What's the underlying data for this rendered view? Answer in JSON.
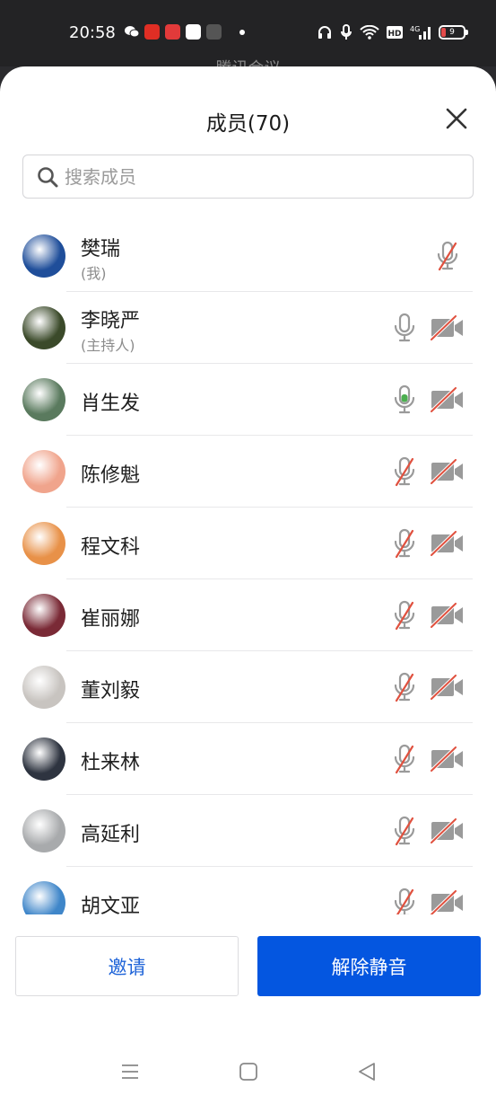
{
  "status_bar": {
    "time": "20:58",
    "battery": "9",
    "app_icons": [
      "wechat-icon",
      "pinduoduo-icon",
      "toutiao-icon",
      "baidu-icon",
      "music-icon"
    ],
    "system_icons": [
      "headphones-icon",
      "mic-icon",
      "wifi-icon",
      "hd-icon",
      "signal-icon",
      "battery-icon"
    ]
  },
  "background_title": "腾讯会议",
  "sheet": {
    "title": "成员(70)",
    "search_placeholder": "搜索成员"
  },
  "members": [
    {
      "name": "樊瑞",
      "role": "(我)",
      "mic": "muted",
      "camera": "none",
      "avatar_color": "#1f4e9a"
    },
    {
      "name": "李晓严",
      "role": "(主持人)",
      "mic": "on",
      "camera": "off",
      "avatar_color": "#3b4a2a"
    },
    {
      "name": "肖生发",
      "role": "",
      "mic": "speaking",
      "camera": "off",
      "avatar_color": "#5a7a5e"
    },
    {
      "name": "陈修魁",
      "role": "",
      "mic": "muted",
      "camera": "off",
      "avatar_color": "#f0a48c"
    },
    {
      "name": "程文科",
      "role": "",
      "mic": "muted",
      "camera": "off",
      "avatar_color": "#e89148"
    },
    {
      "name": "崔丽娜",
      "role": "",
      "mic": "muted",
      "camera": "off",
      "avatar_color": "#7a2a36"
    },
    {
      "name": "董刘毅",
      "role": "",
      "mic": "muted",
      "camera": "off",
      "avatar_color": "#c8c4c0"
    },
    {
      "name": "杜来林",
      "role": "",
      "mic": "muted",
      "camera": "off",
      "avatar_color": "#2e3440"
    },
    {
      "name": "高延利",
      "role": "",
      "mic": "muted",
      "camera": "off",
      "avatar_color": "#a8aaac"
    },
    {
      "name": "胡文亚",
      "role": "",
      "mic": "muted",
      "camera": "off",
      "avatar_color": "#3f86c9"
    }
  ],
  "buttons": {
    "invite": "邀请",
    "unmute_all": "解除静音"
  },
  "colors": {
    "accent": "#0456e0",
    "muted_red": "#e0513f",
    "speaking_green": "#4caf50"
  }
}
